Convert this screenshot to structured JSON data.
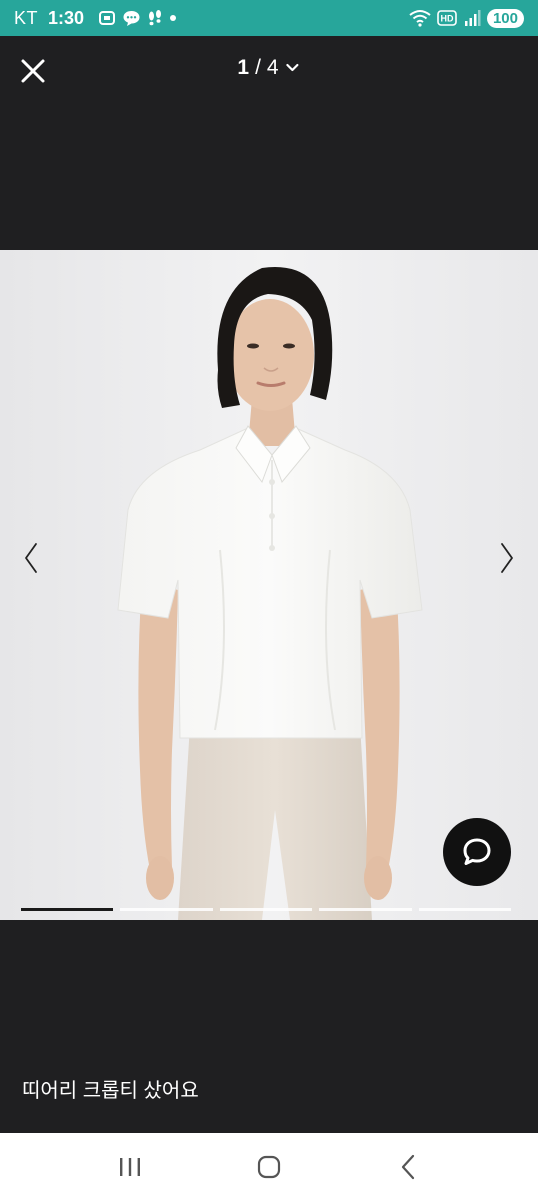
{
  "status_bar": {
    "carrier": "KT",
    "time": "1:30",
    "notification_icons": [
      "screenshot-icon",
      "chat-bubble-icon",
      "footsteps-icon",
      "dot-icon"
    ],
    "system_icons": [
      "wifi-icon",
      "hd-icon",
      "signal-icon"
    ],
    "battery": "100"
  },
  "viewer": {
    "page_current": "1",
    "page_separator": "/",
    "page_total": "4",
    "slide_progress": {
      "active_index": 0,
      "count": 5
    }
  },
  "post": {
    "caption": "띠어리 크롭티 샀어요"
  },
  "colors": {
    "status_bar_bg": "#27a69b",
    "viewer_bg": "#1f1f21",
    "photo_bg": "#ececee",
    "fab_bg": "#111111"
  }
}
